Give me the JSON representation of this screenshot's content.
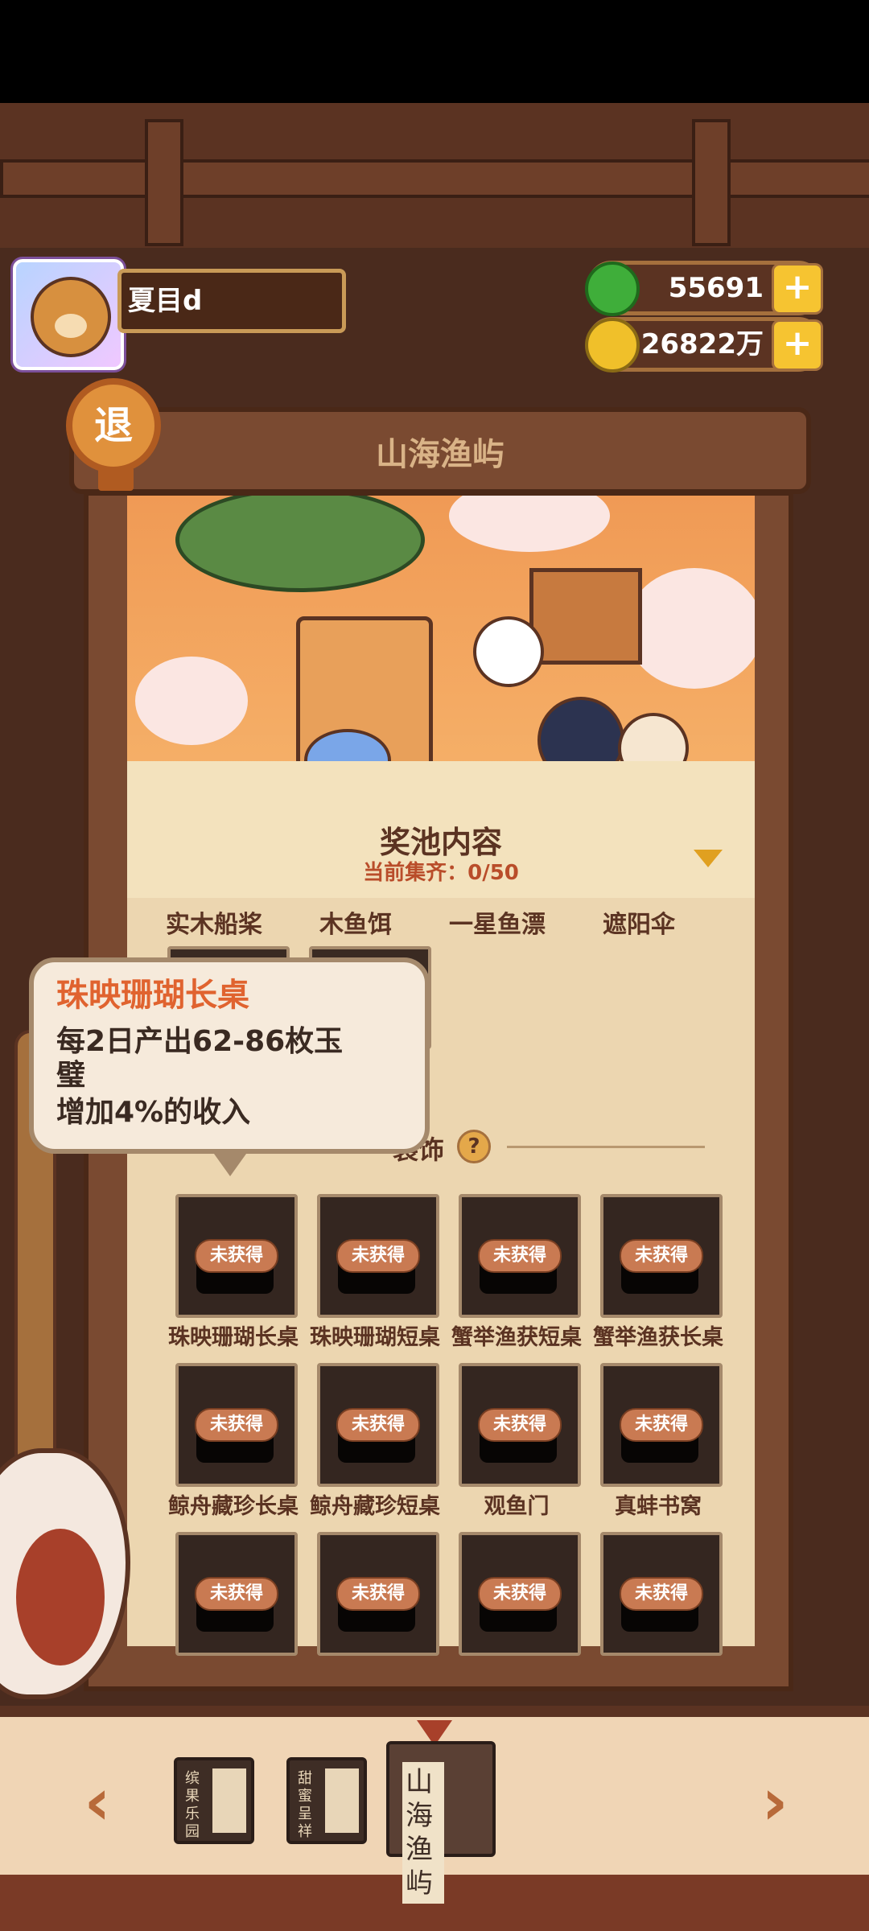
{
  "player": {
    "name": "夏目d"
  },
  "currencies": [
    {
      "icon": "jade-coin-icon",
      "value": "55691"
    },
    {
      "icon": "gold-coin-icon",
      "value": "26822万"
    }
  ],
  "exit_label": "退",
  "scroll_title": "山海渔屿",
  "pool": {
    "title": "奖池内容",
    "count_text": "当前集齐：0/50"
  },
  "row_labels": [
    "实木船桨",
    "木鱼饵",
    "一星鱼漂",
    "遮阳伞"
  ],
  "section": {
    "title": "装饰",
    "help": "?"
  },
  "items": [
    {
      "name": "珠映珊瑚长桌",
      "status": "未获得"
    },
    {
      "name": "珠映珊瑚短桌",
      "status": "未获得"
    },
    {
      "name": "蟹举渔获短桌",
      "status": "未获得"
    },
    {
      "name": "蟹举渔获长桌",
      "status": "未获得"
    },
    {
      "name": "鲸舟藏珍长桌",
      "status": "未获得"
    },
    {
      "name": "鲸舟藏珍短桌",
      "status": "未获得"
    },
    {
      "name": "观鱼门",
      "status": "未获得"
    },
    {
      "name": "真蚌书窝",
      "status": "未获得"
    },
    {
      "name": "",
      "status": "未获得"
    },
    {
      "name": "",
      "status": "未获得"
    },
    {
      "name": "",
      "status": "未获得"
    },
    {
      "name": "",
      "status": "未获得"
    }
  ],
  "tooltip": {
    "title": "珠映珊瑚长桌",
    "line1": "每2日产出62-86枚玉",
    "line2": "璧",
    "line3": "增加4%的收入"
  },
  "books": [
    {
      "label": "缤果乐园"
    },
    {
      "label": "甜蜜呈祥"
    },
    {
      "label": "山海渔屿"
    }
  ],
  "colors": {
    "accent": "#e0632f",
    "wood": "#5b3322",
    "paper": "#ecd6b0"
  }
}
